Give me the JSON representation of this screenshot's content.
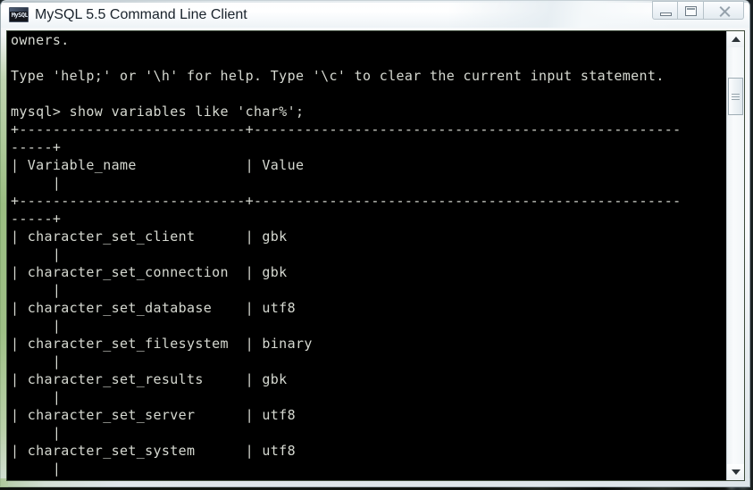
{
  "window": {
    "title": "MySQL 5.5 Command Line Client",
    "icon_name": "mysql-console-icon",
    "icon_text": "MySQL",
    "buttons": {
      "minimize": "Minimize",
      "maximize": "Maximize",
      "close": "Close"
    }
  },
  "console": {
    "prompt": "mysql>",
    "command": "show variables like 'char%';",
    "lines": [
      "owners.",
      "",
      "Type 'help;' or '\\h' for help. Type '\\c' to clear the current input statement.",
      "",
      "mysql> show variables like 'char%';",
      "+---------------------------+---------------------------------------------------",
      "-----+",
      "| Variable_name             | Value",
      "     |",
      "+---------------------------+---------------------------------------------------",
      "-----+",
      "| character_set_client      | gbk",
      "     |",
      "| character_set_connection  | gbk",
      "     |",
      "| character_set_database    | utf8",
      "     |",
      "| character_set_filesystem  | binary",
      "     |",
      "| character_set_results     | gbk",
      "     |",
      "| character_set_server      | utf8",
      "     |",
      "| character_set_system      | utf8",
      "     |"
    ],
    "table": {
      "headers": [
        "Variable_name",
        "Value"
      ],
      "rows": [
        [
          "character_set_client",
          "gbk"
        ],
        [
          "character_set_connection",
          "gbk"
        ],
        [
          "character_set_database",
          "utf8"
        ],
        [
          "character_set_filesystem",
          "binary"
        ],
        [
          "character_set_results",
          "gbk"
        ],
        [
          "character_set_server",
          "utf8"
        ],
        [
          "character_set_system",
          "utf8"
        ]
      ]
    },
    "colors": {
      "background": "#000000",
      "foreground": "#d6d9d1"
    }
  },
  "scrollbar": {
    "up_arrow": "Scroll up",
    "down_arrow": "Scroll down",
    "thumb": "Scroll thumb"
  }
}
